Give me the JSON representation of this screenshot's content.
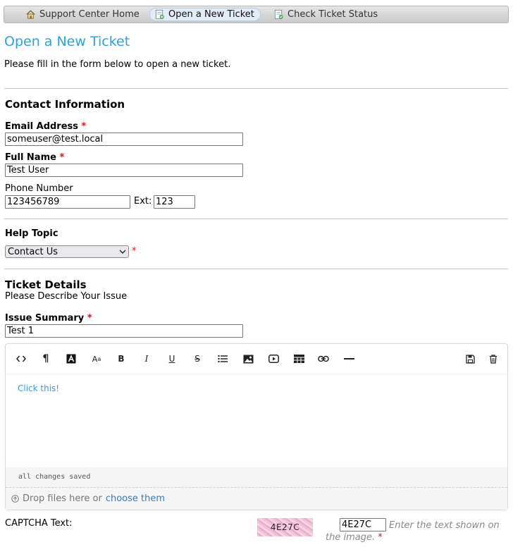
{
  "nav": {
    "items": [
      {
        "label": "Support Center Home",
        "icon": "home-icon"
      },
      {
        "label": "Open a New Ticket",
        "icon": "new-ticket-icon"
      },
      {
        "label": "Check Ticket Status",
        "icon": "ticket-status-icon"
      }
    ]
  },
  "page": {
    "title": "Open a New Ticket",
    "intro": "Please fill in the form below to open a new ticket."
  },
  "contact": {
    "heading": "Contact Information",
    "email_label": "Email Address",
    "email_value": "someuser@test.local",
    "name_label": "Full Name",
    "name_value": "Test User",
    "phone_label": "Phone Number",
    "phone_value": "123456789",
    "ext_label": "Ext:",
    "ext_value": "123"
  },
  "help_topic": {
    "heading": "Help Topic",
    "selected": "Contact Us"
  },
  "details": {
    "heading": "Ticket Details",
    "subheading": "Please Describe Your Issue",
    "summary_label": "Issue Summary",
    "summary_value": "Test 1"
  },
  "editor": {
    "toolbar": [
      "code-view-icon",
      "paragraph-icon",
      "font-color-icon",
      "font-size-icon",
      "bold-icon",
      "italic-icon",
      "underline-icon",
      "strikethrough-icon",
      "list-icon",
      "image-icon",
      "video-icon",
      "table-icon",
      "link-icon",
      "horizontal-rule-icon",
      "save-icon",
      "trash-icon"
    ],
    "body_text": "Click this!",
    "status": "all changes saved",
    "drop_text": "Drop files here or",
    "drop_link": "choose them"
  },
  "captcha": {
    "label": "CAPTCHA Text:",
    "image_text": "4E27C",
    "input_value": "4E27C",
    "hint": "Enter the text shown on the image."
  },
  "required_mark": "*",
  "colors": {
    "title": "#29a3d8",
    "required": "#e01010",
    "link": "#3a7bb8"
  }
}
